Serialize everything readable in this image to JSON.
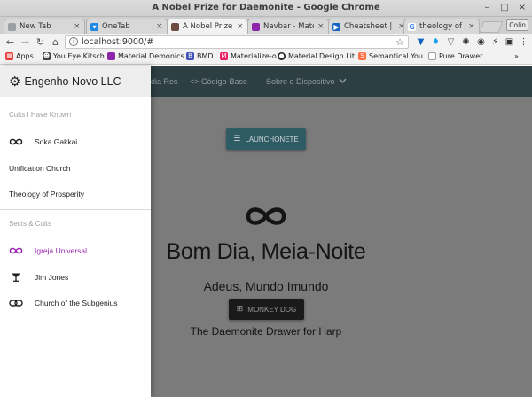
{
  "window": {
    "title": "A Nobel Prize for Daemonite - Google Chrome",
    "controls": [
      "–",
      "□",
      "×"
    ]
  },
  "tabs": [
    {
      "label": "New Tab",
      "favicon": "newtab-icon",
      "color": "#9aa0a6",
      "active": false
    },
    {
      "label": "OneTab",
      "favicon": "onetab-icon",
      "color": "#1e88e5",
      "active": false
    },
    {
      "label": "A Nobel Prize fo",
      "favicon": "daemonite-icon",
      "color": "#6d4c41",
      "active": true
    },
    {
      "label": "Navbar - Mate",
      "favicon": "materialize-icon",
      "color": "#8e24aa",
      "active": false
    },
    {
      "label": "Cheatsheet | F",
      "favicon": "cheatsheet-icon",
      "color": "#1565c0",
      "active": false
    },
    {
      "label": "theology of w",
      "favicon": "google-icon",
      "color": "#4285f4",
      "active": false
    }
  ],
  "user_badge": "Colin",
  "address": {
    "url": "localhost:9000/#"
  },
  "bookmarks": {
    "more": "»",
    "items": [
      {
        "label": "Apps",
        "icon": "apps-icon",
        "color": "#e53935"
      },
      {
        "label": "You Eye Kitsch",
        "icon": "you-eye-kitsch-icon",
        "color": "#424242"
      },
      {
        "label": "Material Demonics",
        "icon": "material-icon",
        "color": "#8e24aa"
      },
      {
        "label": "BMD",
        "icon": "bmd-icon",
        "color": "#3f51b5"
      },
      {
        "label": "Materialize-o",
        "icon": "materialize-icon",
        "color": "#e91e63"
      },
      {
        "label": "Material Design Lit",
        "icon": "github-icon",
        "color": "#212121"
      },
      {
        "label": "Semantical You",
        "icon": "semantical-icon",
        "color": "#ff7043"
      },
      {
        "label": "Pure Drawer",
        "icon": "page-icon",
        "color": "#9e9e9e"
      }
    ]
  },
  "navbar": {
    "links": [
      "dia Res",
      "<> Código-Base",
      "Sobre o Dispositivo"
    ]
  },
  "hero": {
    "launch_label": "LAUNCHONETE",
    "title": "Bom Dia, Meia-Noite",
    "subtitle": "Adeus, Mundo Imundo",
    "dog_label": "MONKEY DOG",
    "footer": "The Daemonite Drawer for Harp"
  },
  "drawer": {
    "brand": "Engenho Novo LLC",
    "section1": {
      "header": "Cults I Have Known",
      "items": [
        {
          "label": "Soka Gakkai",
          "icon": "infinity-icon"
        },
        {
          "label": "Unification Church",
          "icon": ""
        },
        {
          "label": "Theology of Prosperity",
          "icon": ""
        }
      ]
    },
    "section2": {
      "header": "Sects & Cults",
      "items": [
        {
          "label": "Igreja Universal",
          "icon": "infinity-icon",
          "selected": true
        },
        {
          "label": "Jim Jones",
          "icon": "cocktail-icon"
        },
        {
          "label": "Church of the Subgenius",
          "icon": "link-icon"
        }
      ]
    },
    "accent_color": "#9c27b0"
  },
  "colors": {
    "navbar_bg": "#2d3f43",
    "scrim": "#7b7b7b",
    "launch_button": "#2e5b64",
    "dog_button": "#1a1a1a"
  }
}
